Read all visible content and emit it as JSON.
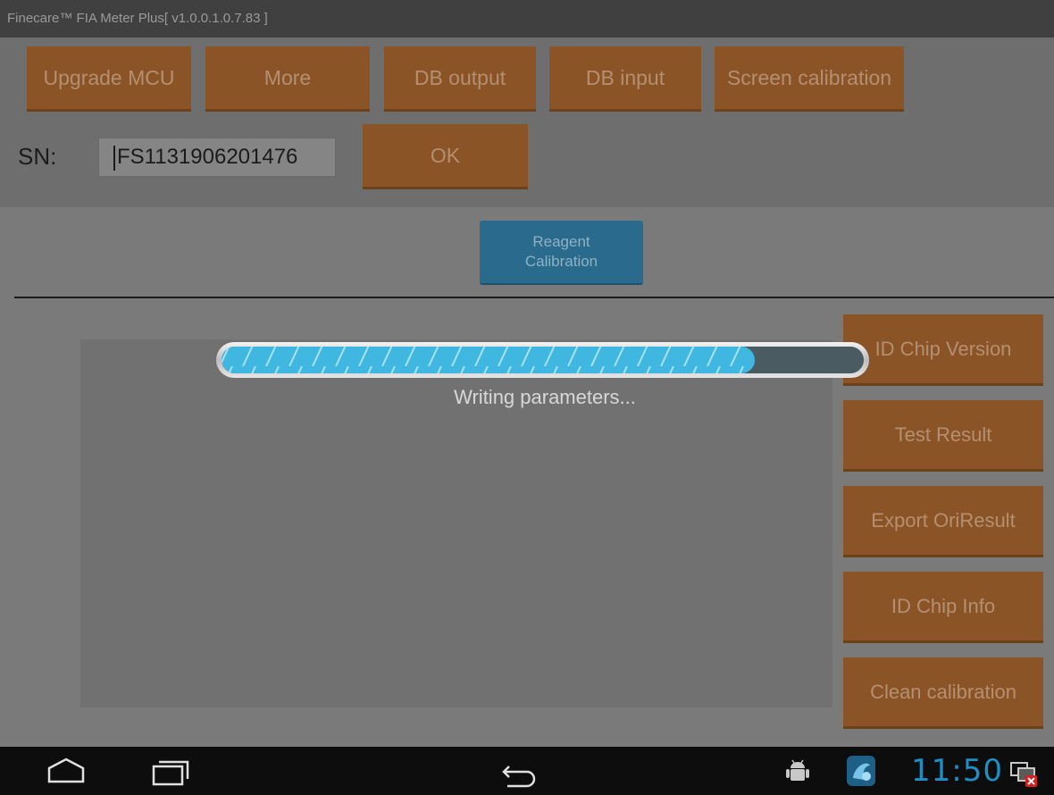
{
  "window": {
    "title": "Finecare™ FIA Meter Plus[ v1.0.0.1.0.7.83 ]"
  },
  "toolbar": {
    "buttons": [
      {
        "label": "Upgrade MCU"
      },
      {
        "label": "More"
      },
      {
        "label": "DB output"
      },
      {
        "label": "DB input"
      },
      {
        "label": "Screen calibration"
      }
    ]
  },
  "serial": {
    "label": "SN:",
    "value": "FS1131906201476",
    "ok_label": "OK"
  },
  "reagent": {
    "line1": "Reagent",
    "line2": "Calibration"
  },
  "side_buttons": [
    {
      "label": "ID Chip Version"
    },
    {
      "label": "Test Result"
    },
    {
      "label": "Export OriResult"
    },
    {
      "label": "ID Chip Info"
    },
    {
      "label": "Clean calibration"
    }
  ],
  "progress": {
    "fraction": 0.83,
    "message": "Writing parameters..."
  },
  "statusbar": {
    "time": "11:50",
    "icons": [
      "home-icon",
      "recent-apps-icon",
      "back-icon",
      "android-debug-icon",
      "app-notification-icon",
      "network-disconnected-icon"
    ]
  },
  "colors": {
    "accent_orange": "#8a5426",
    "accent_blue": "#2a6a8c",
    "progress_fill": "#3fb7e0",
    "clock": "#1c8fc4"
  }
}
